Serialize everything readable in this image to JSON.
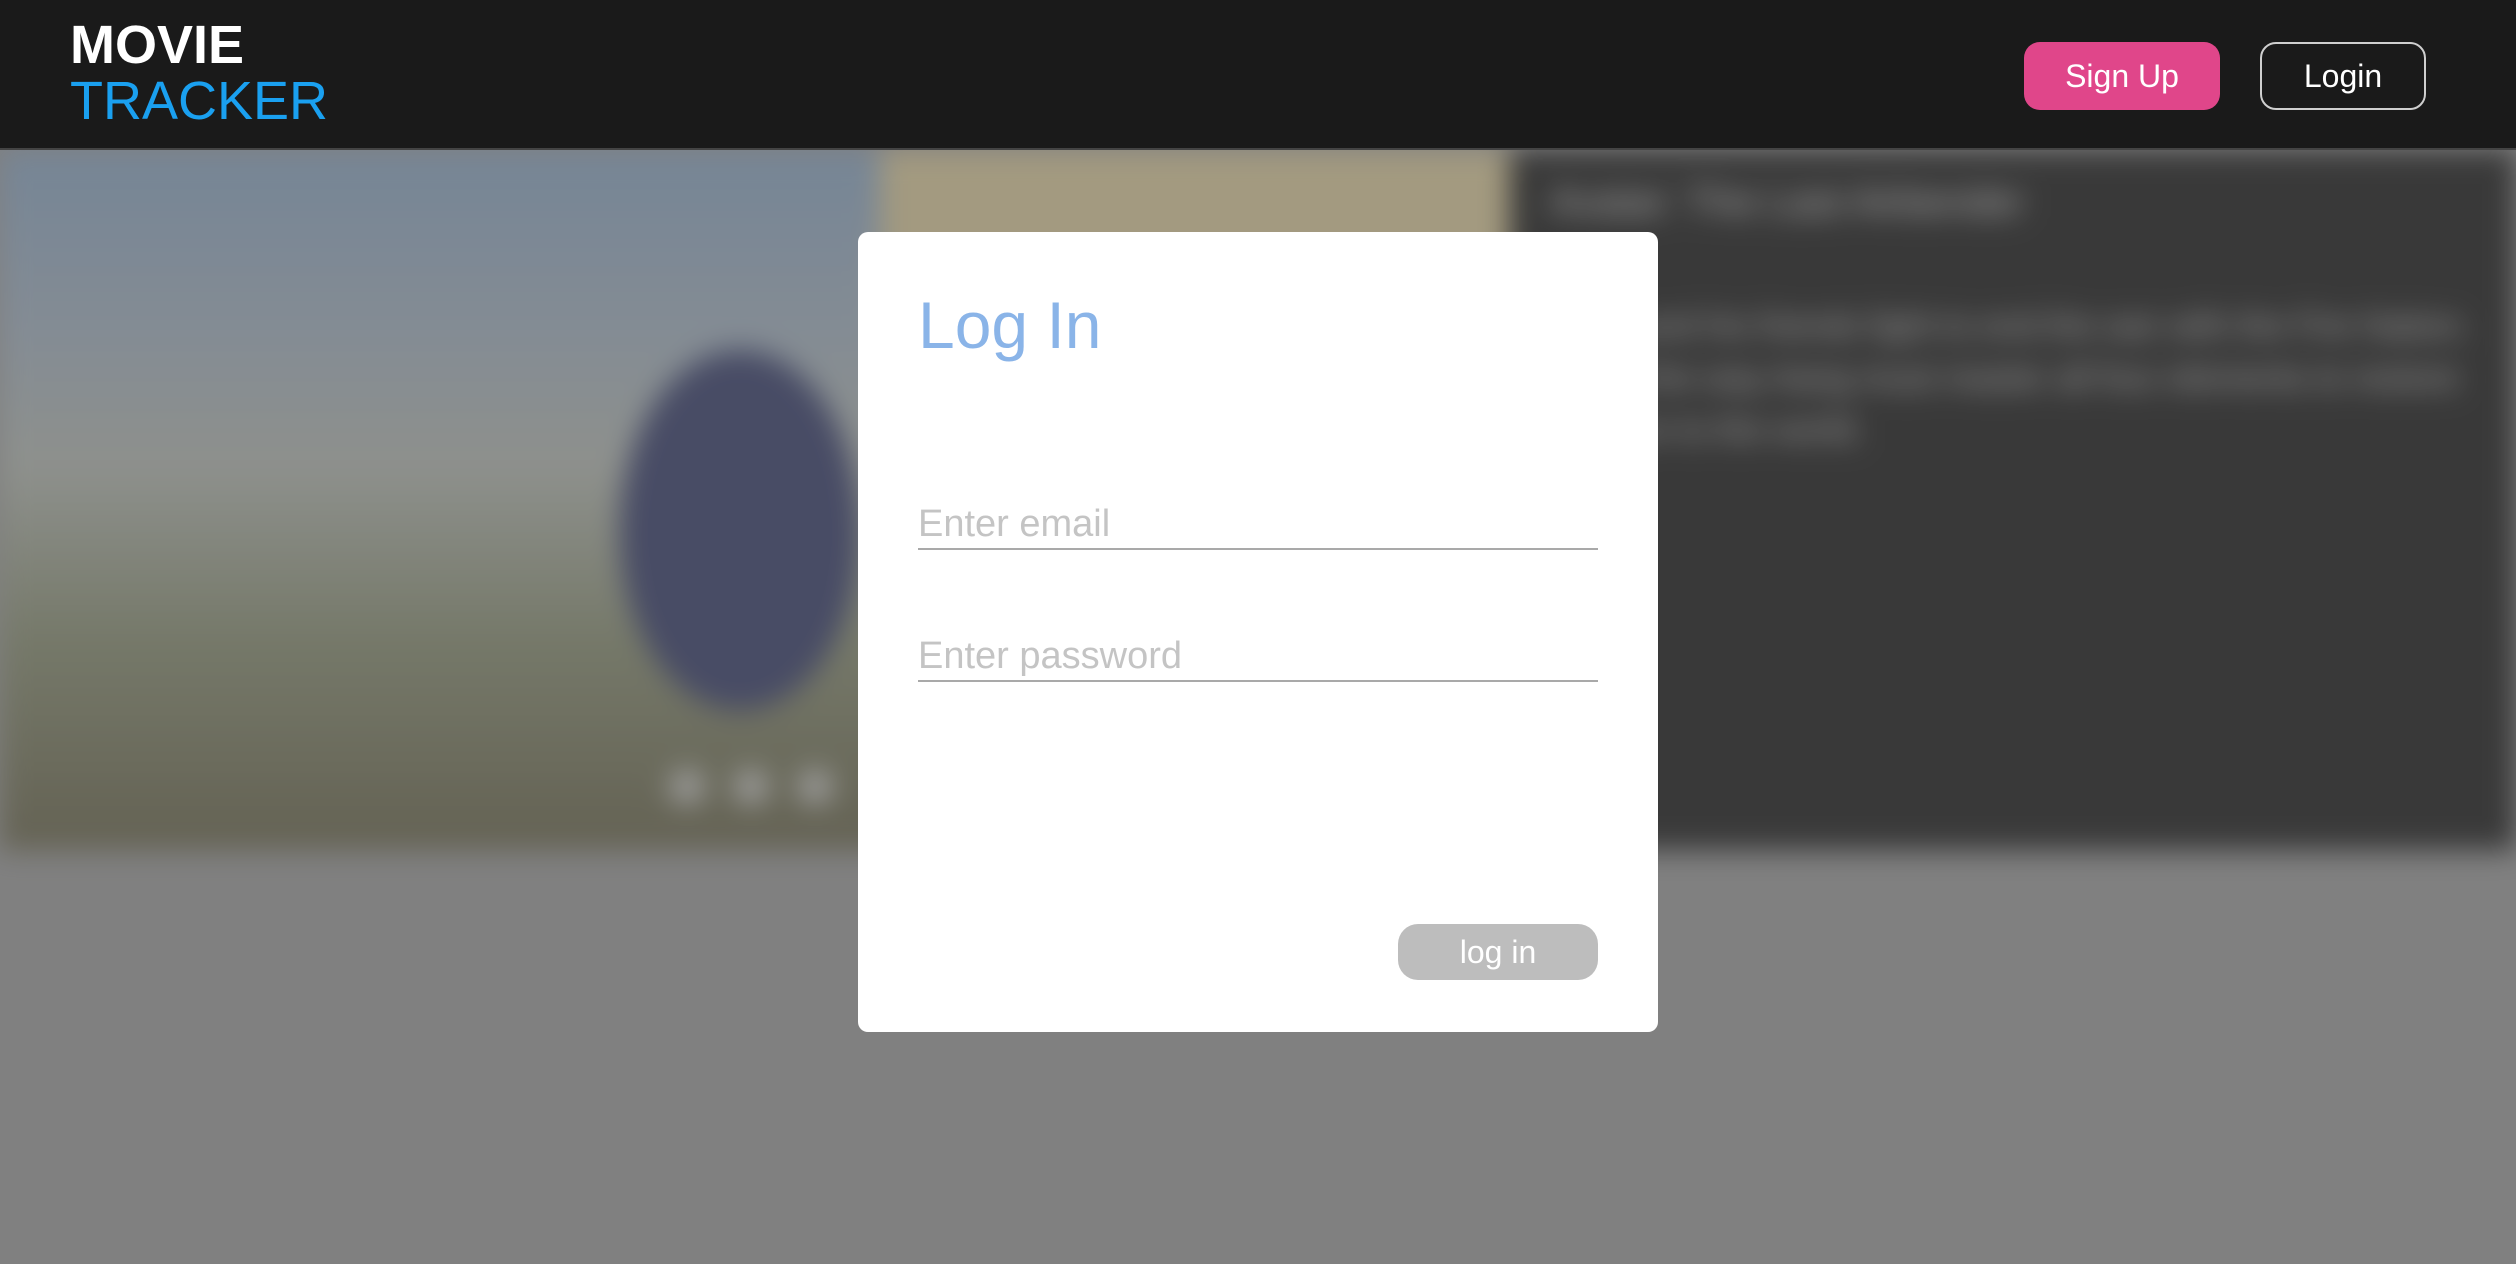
{
  "header": {
    "logo_line1": "MOVIE",
    "logo_line2": "TRACKER",
    "signup_label": "Sign Up",
    "login_label": "Login"
  },
  "hero": {
    "title": "Avatar: The Last Airbender",
    "description": "Aang and his friends fight to end the war with the Fire Nation. Along the way Aang must master all four elements to restore balance to the world."
  },
  "modal": {
    "title": "Log In",
    "email_placeholder": "Enter email",
    "password_placeholder": "Enter password",
    "submit_label": "log in"
  },
  "colors": {
    "header_bg": "#1a1a1a",
    "logo_accent": "#1aa0f0",
    "signup_bg": "#e0468a",
    "modal_title": "#8ab4e8",
    "submit_bg": "#bdbdbd",
    "backdrop": "#808080"
  }
}
